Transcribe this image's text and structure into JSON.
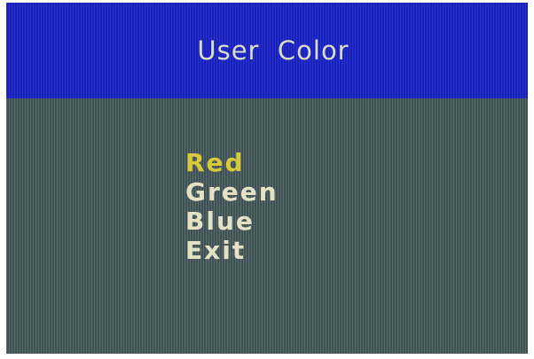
{
  "osd": {
    "title": "User  Color",
    "menu": {
      "items": [
        {
          "label": "Red",
          "selected": true
        },
        {
          "label": "Green",
          "selected": false
        },
        {
          "label": "Blue",
          "selected": false
        },
        {
          "label": "Exit",
          "selected": false
        }
      ]
    },
    "colors": {
      "header_bg": "#1c24c8",
      "body_bg": "#475a5e",
      "text": "#e4e2c4",
      "selected_text": "#d9c93a"
    }
  }
}
